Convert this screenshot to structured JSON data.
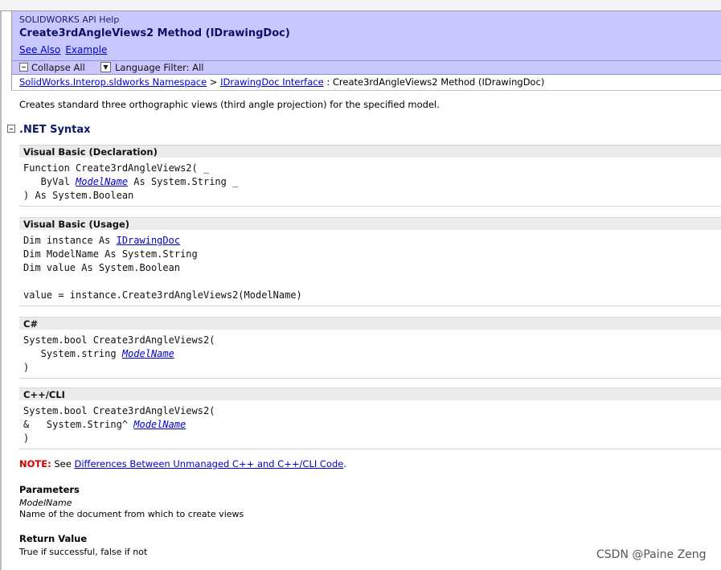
{
  "header": {
    "product": "SOLIDWORKS API Help",
    "title": "Create3rdAngleViews2 Method (IDrawingDoc)",
    "see_also": "See Also",
    "example": "Example"
  },
  "toolbar": {
    "collapse_all": "Collapse All",
    "language_filter": "Language Filter: All"
  },
  "breadcrumb": {
    "namespace": "SolidWorks.Interop.sldworks Namespace",
    "sep1": " > ",
    "interface": "IDrawingDoc Interface",
    "sep2": " : ",
    "current": "Create3rdAngleViews2 Method (IDrawingDoc)"
  },
  "summary": "Creates standard three orthographic views (third angle projection) for the specified model.",
  "syntax": {
    "section_title": ".NET Syntax",
    "vb_declaration": {
      "header": "Visual Basic (Declaration)",
      "line1": "Function Create3rdAngleViews2( _",
      "line2_prefix": "   ByVal ",
      "line2_param": "ModelName",
      "line2_suffix": " As System.String _",
      "line3": ") As System.Boolean"
    },
    "vb_usage": {
      "header": "Visual Basic (Usage)",
      "line1_prefix": "Dim instance As ",
      "line1_type": "IDrawingDoc",
      "line2": "Dim ModelName As System.String",
      "line3": "Dim value As System.Boolean",
      "line4": "",
      "line5": "value = instance.Create3rdAngleViews2(ModelName)"
    },
    "csharp": {
      "header": "C#",
      "line1": "System.bool Create3rdAngleViews2(",
      "line2_prefix": "   System.string ",
      "line2_param": "ModelName",
      "line3": ")"
    },
    "cpp_cli": {
      "header": "C++/CLI",
      "line1": "System.bool Create3rdAngleViews2(",
      "line2_prefix": "&   System.String^ ",
      "line2_param": "ModelName",
      "line3": ")"
    }
  },
  "note": {
    "label": "NOTE:",
    "text": " See ",
    "link": "Differences Between Unmanaged C++ and C++/CLI Code",
    "end": "."
  },
  "parameters": {
    "heading": "Parameters",
    "name": "ModelName",
    "description": "Name of the document from which to create views"
  },
  "return_value": {
    "heading": "Return Value",
    "description": "True if successful, false if not"
  },
  "watermark": "CSDN @Paine Zeng"
}
